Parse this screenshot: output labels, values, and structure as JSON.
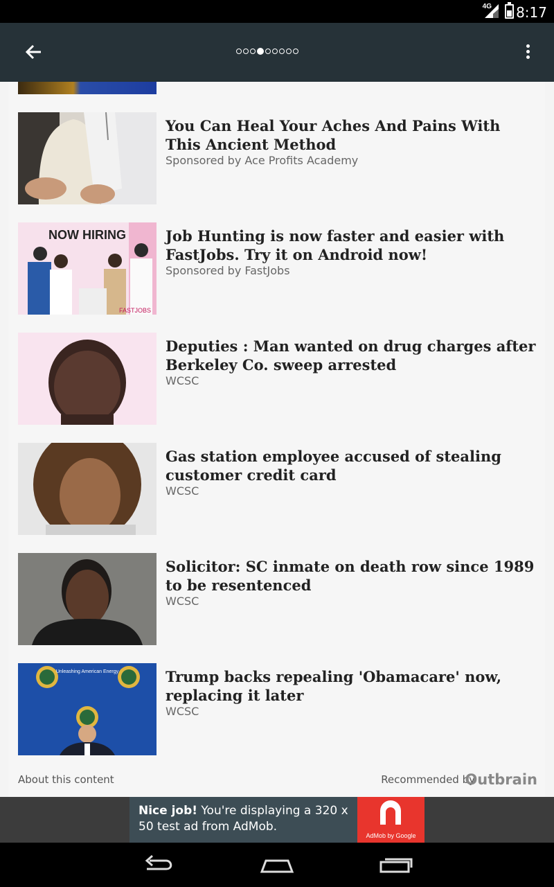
{
  "status_bar": {
    "time": "8:17",
    "network": "4G"
  },
  "app_bar": {
    "pager_total": 9,
    "pager_active": 3
  },
  "articles": [
    {
      "headline": "You Can Heal Your Aches And Pains With This Ancient Method",
      "source": "Sponsored by Ace Profits Academy",
      "thumb_icon": "acupuncture-model-image"
    },
    {
      "headline": "Job Hunting is now faster and easier with FastJobs. Try it on Android now!",
      "source": "Sponsored by FastJobs",
      "thumb_icon": "now-hiring-image",
      "thumb_title": "NOW HIRING",
      "thumb_brand": "FASTJOBS"
    },
    {
      "headline": "Deputies : Man wanted on drug charges after Berkeley Co. sweep arrested",
      "source": "WCSC",
      "thumb_icon": "mugshot-image"
    },
    {
      "headline": "Gas station employee accused of stealing customer credit card",
      "source": "WCSC",
      "thumb_icon": "mugshot-image"
    },
    {
      "headline": "Solicitor: SC inmate on death row since 1989 to be resentenced",
      "source": "WCSC",
      "thumb_icon": "mugshot-image"
    },
    {
      "headline": "Trump backs repealing 'Obamacare' now, replacing it later",
      "source": "WCSC",
      "thumb_icon": "press-conference-image",
      "thumb_seal_text": "Unleashing American Energy"
    }
  ],
  "footer": {
    "about": "About this content",
    "recommended": "Recommended by",
    "brand": "Outbrain"
  },
  "ad": {
    "bold": "Nice job!",
    "text": " You're displaying a 320 x 50 test ad from AdMob.",
    "logo_label": "AdMob by Google"
  },
  "colors": {
    "app_bar": "#263238",
    "ad_logo": "#e8352d"
  }
}
